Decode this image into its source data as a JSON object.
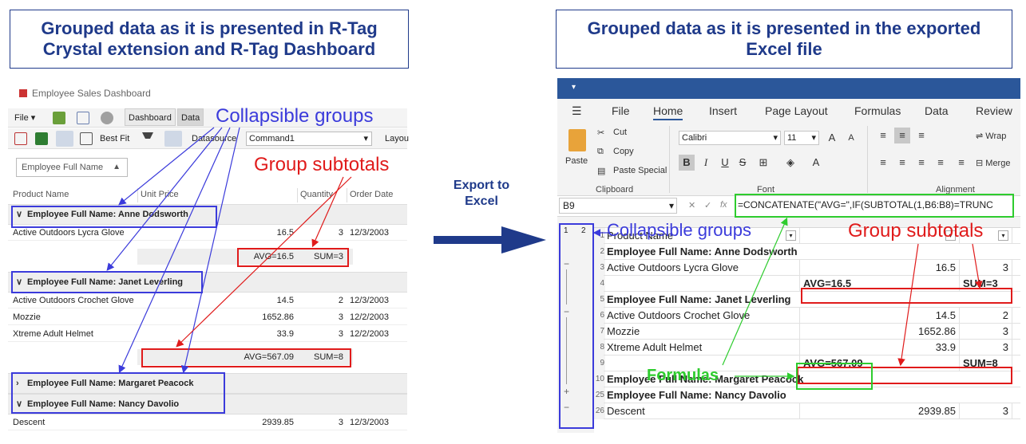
{
  "titles": {
    "left": "Grouped data as it is presented in R-Tag Crystal extension and R-Tag Dashboard",
    "right": "Grouped data as it is presented in the exported Excel file"
  },
  "export_label": "Export to Excel",
  "annotations": {
    "collapsible": "Collapsible groups",
    "subtotals": "Group subtotals",
    "formulas": "Formulas"
  },
  "dashboard": {
    "window_title": "Employee Sales Dashboard",
    "menu_file": "File",
    "tab_dashboard": "Dashboard",
    "tab_data": "Data",
    "best_fit": "Best Fit",
    "datasource_label": "Datasource",
    "datasource_value": "Command1",
    "layout_label": "Layou",
    "group_panel": "Employee Full Name",
    "columns": [
      "Product Name",
      "Unit Price",
      "Quantity",
      "Order Date"
    ],
    "groups": [
      {
        "label": "Employee Full Name: Anne Dodsworth",
        "rows": [
          [
            "Active Outdoors Lycra Glove",
            "16.5",
            "3",
            "12/3/2003"
          ]
        ],
        "avg": "AVG=16.5",
        "sum": "SUM=3"
      },
      {
        "label": "Employee Full Name: Janet Leverling",
        "rows": [
          [
            "Active Outdoors Crochet Glove",
            "14.5",
            "2",
            "12/3/2003"
          ],
          [
            "Mozzie",
            "1652.86",
            "3",
            "12/2/2003"
          ],
          [
            "Xtreme Adult Helmet",
            "33.9",
            "3",
            "12/2/2003"
          ]
        ],
        "avg": "AVG=567.09",
        "sum": "SUM=8"
      },
      {
        "label": "Employee Full Name: Margaret Peacock"
      },
      {
        "label": "Employee Full Name: Nancy Davolio",
        "rows": [
          [
            "Descent",
            "2939.85",
            "3",
            "12/3/2003"
          ]
        ]
      }
    ]
  },
  "excel": {
    "tabs": [
      "File",
      "Home",
      "Insert",
      "Page Layout",
      "Formulas",
      "Data",
      "Review"
    ],
    "clipboard": {
      "cut": "Cut",
      "copy": "Copy",
      "paste": "Paste",
      "paste_special": "Paste Special",
      "group": "Clipboard"
    },
    "font": {
      "name": "Calibri",
      "size": "11",
      "group": "Font"
    },
    "alignment": {
      "wrap": "Wrap",
      "merge": "Merge",
      "group": "Alignment"
    },
    "name_box": "B9",
    "formula": "=CONCATENATE(\"AVG=\",IF(SUBTOTAL(1,B6:B8)=TRUNC",
    "outline_levels": [
      "1",
      "2"
    ],
    "rows": [
      {
        "n": "1",
        "a": "Product Name",
        "b": "",
        "c": ""
      },
      {
        "n": "2",
        "a": "Employee Full Name: Anne Dodsworth",
        "b": "",
        "c": "",
        "group": true
      },
      {
        "n": "3",
        "a": "Active Outdoors Lycra Glove",
        "b": "16.5",
        "c": "3"
      },
      {
        "n": "4",
        "a": "",
        "b": "AVG=16.5",
        "c": "SUM=3",
        "sub": true
      },
      {
        "n": "5",
        "a": "Employee Full Name: Janet Leverling",
        "b": "",
        "c": "",
        "group": true
      },
      {
        "n": "6",
        "a": "Active Outdoors Crochet Glove",
        "b": "14.5",
        "c": "2"
      },
      {
        "n": "7",
        "a": "Mozzie",
        "b": "1652.86",
        "c": "3"
      },
      {
        "n": "8",
        "a": "Xtreme Adult Helmet",
        "b": "33.9",
        "c": "3"
      },
      {
        "n": "9",
        "a": "",
        "b": "AVG=567.09",
        "c": "SUM=8",
        "sub": true
      },
      {
        "n": "10",
        "a": "Employee Full Name: Margaret Peacock",
        "b": "",
        "c": "",
        "group": true
      },
      {
        "n": "25",
        "a": "Employee Full Name: Nancy Davolio",
        "b": "",
        "c": "",
        "group": true
      },
      {
        "n": "26",
        "a": "Descent",
        "b": "2939.85",
        "c": "3"
      }
    ]
  },
  "colors": {
    "blue": "#3b3bdb",
    "red": "#e01b1b",
    "green": "#2ecc2e",
    "navy": "#1f3a8a",
    "excel": "#2b579a"
  }
}
